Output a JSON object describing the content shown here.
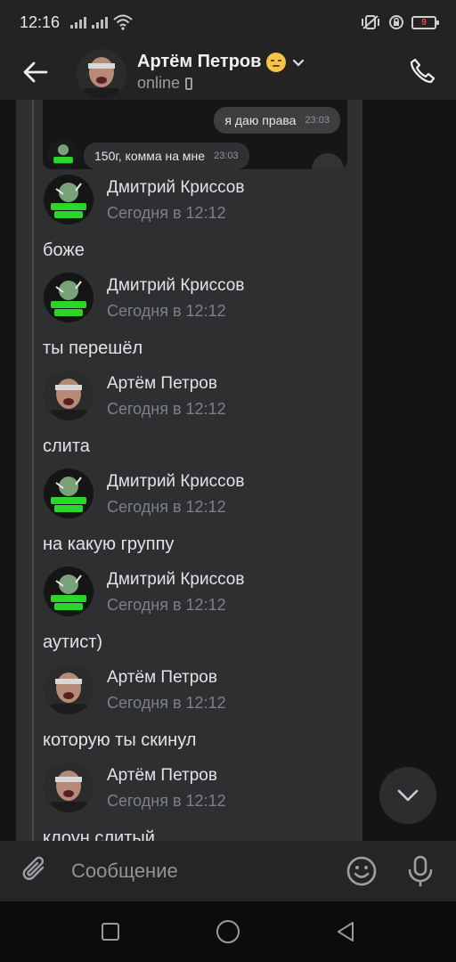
{
  "status_bar": {
    "time": "12:16",
    "battery_level": "9",
    "icons": [
      "signal-icon",
      "signal-icon",
      "wifi-icon",
      "vibrate-icon",
      "alarm-icon",
      "battery-icon"
    ]
  },
  "header": {
    "name": "Артём Петров",
    "status": "online",
    "icons": {
      "back": "arrow-left-icon",
      "call": "phone-icon",
      "expand": "chevron-down-icon"
    }
  },
  "embedded_screenshot": {
    "outgoing": {
      "text": "я даю права",
      "time": "23:03"
    },
    "incoming": {
      "text": "150г, комма на мне",
      "time": "23:03"
    }
  },
  "messages": [
    {
      "author": "Дмитрий Криссов",
      "time": "Сегодня в 12:12",
      "text": "боже",
      "avatar": "kris"
    },
    {
      "author": "Дмитрий Криссов",
      "time": "Сегодня в 12:12",
      "text": "ты перешёл",
      "avatar": "kris"
    },
    {
      "author": "Артём Петров",
      "time": "Сегодня в 12:12",
      "text": "слита",
      "avatar": "artem"
    },
    {
      "author": "Дмитрий Криссов",
      "time": "Сегодня в 12:12",
      "text": "на какую группу",
      "avatar": "kris"
    },
    {
      "author": "Дмитрий Криссов",
      "time": "Сегодня в 12:12",
      "text": "аутист)",
      "avatar": "kris"
    },
    {
      "author": "Артём Петров",
      "time": "Сегодня в 12:12",
      "text": "которую ты скинул",
      "avatar": "artem"
    },
    {
      "author": "Артём Петров",
      "time": "Сегодня в 12:12",
      "text": "клоун слитый",
      "avatar": "artem"
    }
  ],
  "composer": {
    "placeholder": "Сообщение",
    "value": ""
  },
  "colors": {
    "background": "#141414",
    "panel": "#2e2f31",
    "bars": "#232323",
    "text": "#e1e3e6",
    "secondary_text": "#7d8187",
    "accent_green": "#3ddc3d",
    "battery_low": "#e84545"
  }
}
